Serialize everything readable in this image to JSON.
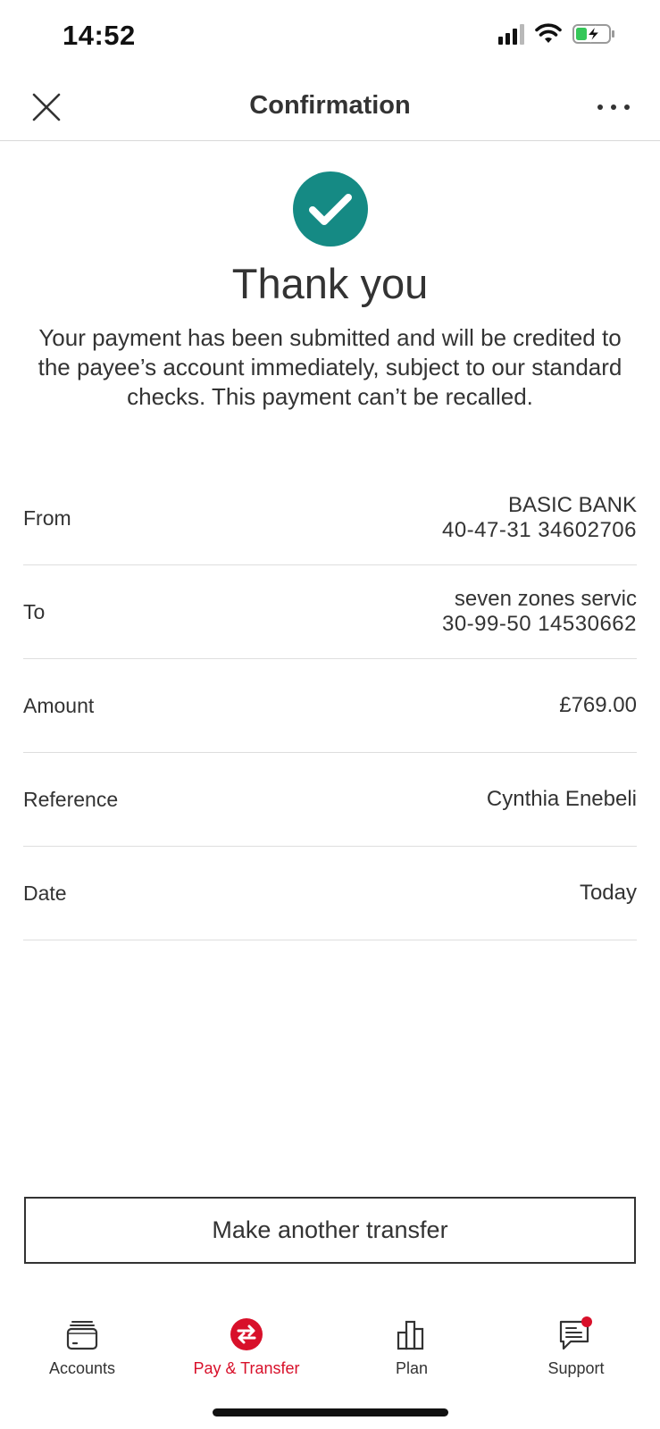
{
  "status_bar": {
    "time": "14:52"
  },
  "header": {
    "title": "Confirmation"
  },
  "confirmation": {
    "title": "Thank you",
    "message": "Your payment has been submitted and will be credited to the payee’s account immediately, subject to our standard checks. This payment can’t be recalled."
  },
  "details": [
    {
      "label": "From",
      "value_line1": "BASIC BANK",
      "value_line2": "40-47-31 34602706"
    },
    {
      "label": "To",
      "value_line1": "seven zones servic",
      "value_line2": "30-99-50 14530662"
    },
    {
      "label": "Amount",
      "value_line1": "£769.00",
      "value_line2": ""
    },
    {
      "label": "Reference",
      "value_line1": "Cynthia Enebeli",
      "value_line2": ""
    },
    {
      "label": "Date",
      "value_line1": "Today",
      "value_line2": ""
    }
  ],
  "actions": {
    "make_another_transfer": "Make another transfer"
  },
  "tabbar": {
    "items": [
      {
        "label": "Accounts",
        "icon": "wallet-icon"
      },
      {
        "label": "Pay & Transfer",
        "icon": "transfer-icon",
        "active": true
      },
      {
        "label": "Plan",
        "icon": "bar-chart-icon"
      },
      {
        "label": "Support",
        "icon": "chat-icon",
        "badge": true
      }
    ]
  },
  "colors": {
    "success": "#158a84",
    "accent": "#d8102a",
    "text": "#333333"
  }
}
